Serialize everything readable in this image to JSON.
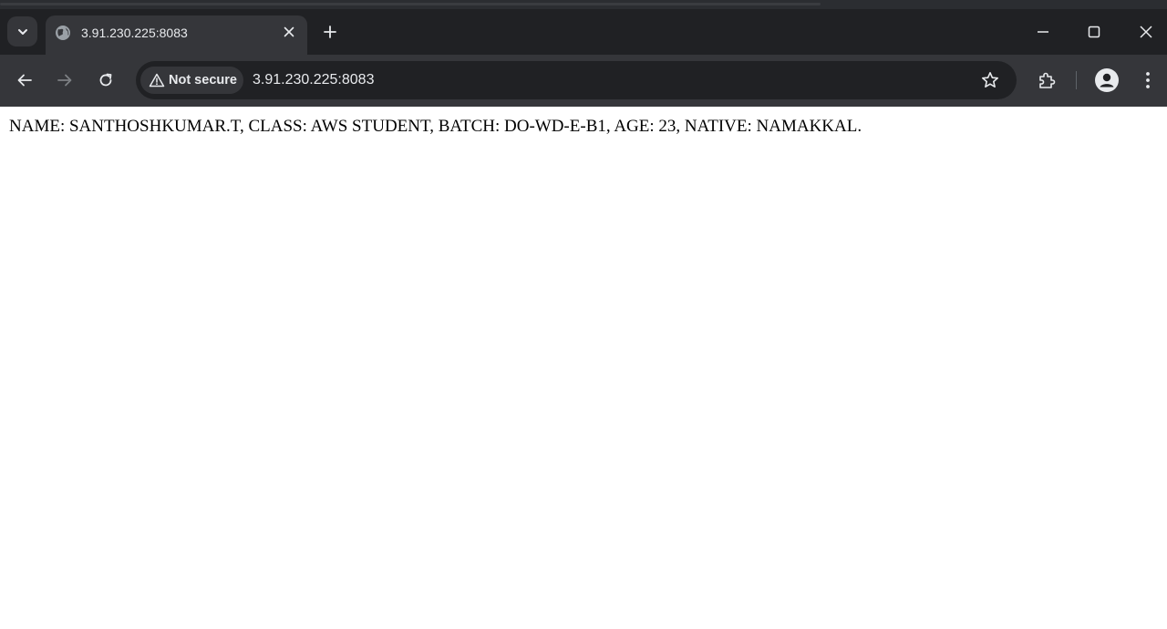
{
  "browser": {
    "tab": {
      "title": "3.91.230.225:8083",
      "favicon": "globe-icon"
    },
    "omnibox": {
      "security_label": "Not secure",
      "url": "3.91.230.225:8083"
    },
    "icons": {
      "tab_search": "chevron-down-icon",
      "close_tab": "close-icon",
      "new_tab": "plus-icon",
      "minimize": "minimize-icon",
      "maximize": "maximize-icon",
      "close_window": "close-icon",
      "back": "arrow-left-icon",
      "forward": "arrow-right-icon",
      "reload": "reload-icon",
      "warning": "warning-icon",
      "bookmark": "star-icon",
      "extensions": "puzzle-icon",
      "profile": "person-icon",
      "menu": "kebab-menu-icon"
    },
    "colors": {
      "tabstrip": "#202124",
      "toolbar": "#35363a",
      "text": "#e8eaed"
    }
  },
  "page": {
    "body_text": "NAME: SANTHOSHKUMAR.T, CLASS: AWS STUDENT, BATCH: DO-WD-E-B1, AGE: 23, NATIVE: NAMAKKAL."
  }
}
